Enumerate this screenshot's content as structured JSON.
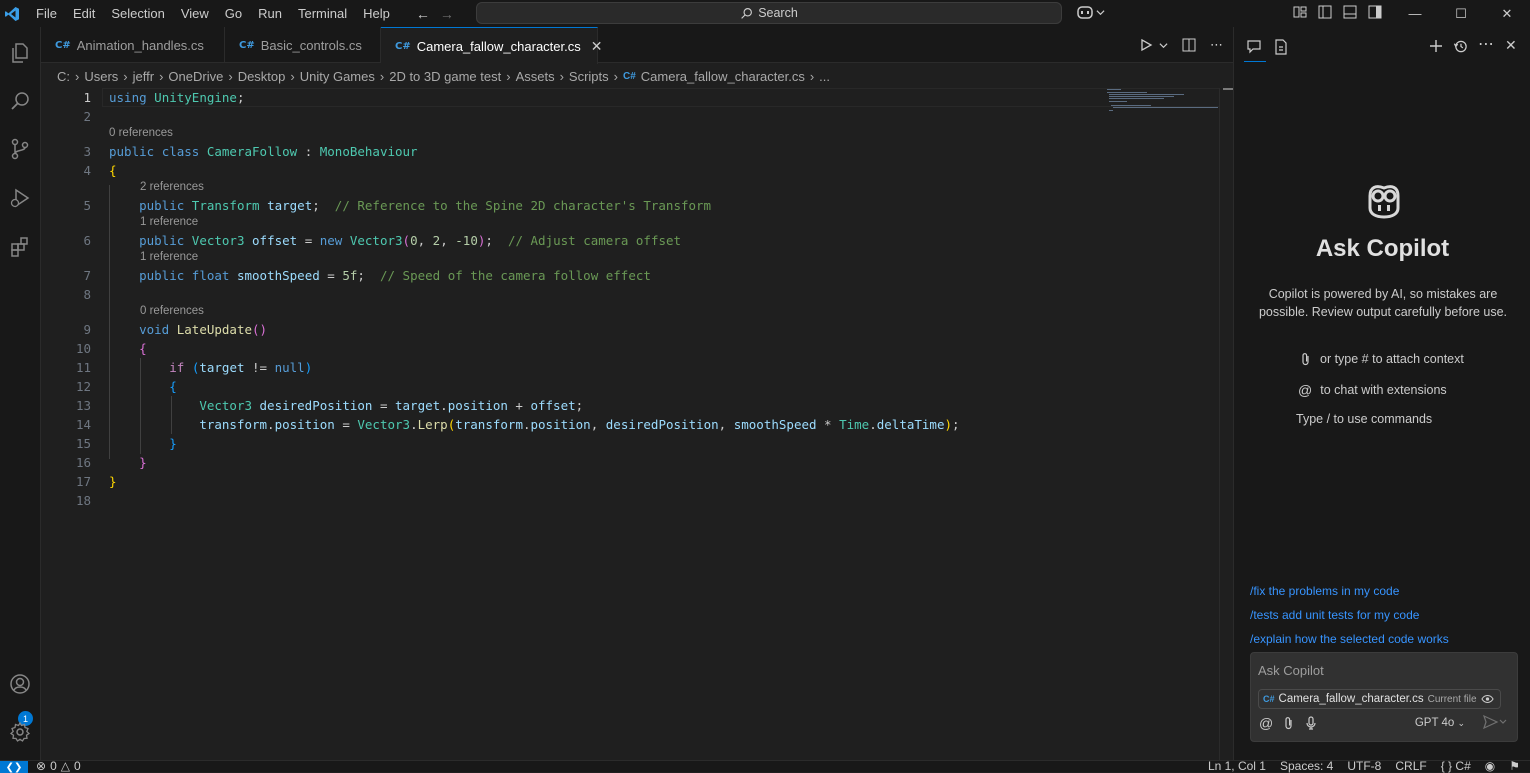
{
  "titlebar": {
    "menu": [
      "File",
      "Edit",
      "Selection",
      "View",
      "Go",
      "Run",
      "Terminal",
      "Help"
    ],
    "search_label": "Search"
  },
  "tabs": [
    {
      "label": "Animation_handles.cs",
      "active": false
    },
    {
      "label": "Basic_controls.cs",
      "active": false
    },
    {
      "label": "Camera_fallow_character.cs",
      "active": true
    }
  ],
  "breadcrumb": [
    "C:",
    "Users",
    "jeffr",
    "OneDrive",
    "Desktop",
    "Unity Games",
    "2D to 3D game test",
    "Assets",
    "Scripts",
    "Camera_fallow_character.cs",
    "..."
  ],
  "editor": {
    "line_numbers": [
      "1",
      "2",
      "3",
      "4",
      "5",
      "6",
      "7",
      "8",
      "9",
      "10",
      "11",
      "12",
      "13",
      "14",
      "15",
      "16",
      "17",
      "18"
    ],
    "codelens": {
      "class": "0 references",
      "target": "2 references",
      "offset": "1 reference",
      "smoothSpeed": "1 reference",
      "lateupdate": "0 references"
    }
  },
  "chat": {
    "title": "Ask Copilot",
    "disclaimer": "Copilot is powered by AI, so mistakes are possible. Review output carefully before use.",
    "hint_attach": "or type # to attach context",
    "hint_extensions": "to chat with extensions",
    "hint_commands": "Type / to use commands",
    "suggestions": [
      "/fix the problems in my code",
      "/tests add unit tests for my code",
      "/explain how the selected code works"
    ],
    "input_placeholder": "Ask Copilot",
    "attachment_file": "Camera_fallow_character.cs",
    "attachment_tag": "Current file",
    "model": "GPT 4o"
  },
  "status": {
    "errors": "0",
    "warnings": "0",
    "cursor": "Ln 1, Col 1",
    "spaces": "Spaces: 4",
    "encoding": "UTF-8",
    "eol": "CRLF",
    "language": "C#",
    "account_badge": "1"
  }
}
